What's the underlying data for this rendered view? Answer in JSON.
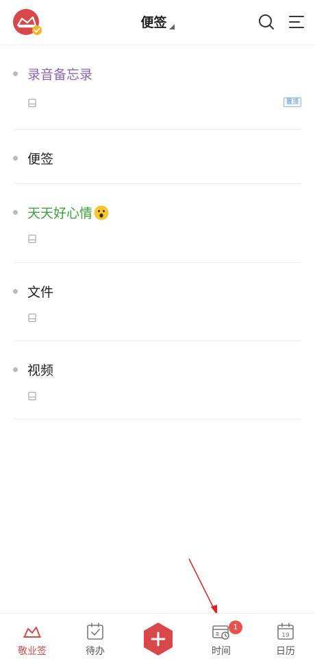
{
  "header": {
    "title": "便签"
  },
  "notes": [
    {
      "title": "录音备忘录",
      "color": "#8a63b8",
      "pinned_label": "置顶"
    },
    {
      "title": "便签",
      "color": "#222222"
    },
    {
      "title": "天天好心情",
      "color": "#3ba33b",
      "emoji": "hushed-face"
    },
    {
      "title": "文件",
      "color": "#222222"
    },
    {
      "title": "视频",
      "color": "#222222"
    }
  ],
  "tabbar": {
    "tabs": [
      {
        "label": "敬业签",
        "icon": "app-logo-icon",
        "active": true
      },
      {
        "label": "待办",
        "icon": "todo-calendar-icon"
      },
      {
        "label": "",
        "icon": "add-icon"
      },
      {
        "label": "时间",
        "icon": "time-icon",
        "badge": "1"
      },
      {
        "label": "日历",
        "icon": "calendar-icon",
        "day": "19"
      }
    ]
  },
  "colors": {
    "accent": "#d8484a",
    "badge": "#e8524e"
  }
}
